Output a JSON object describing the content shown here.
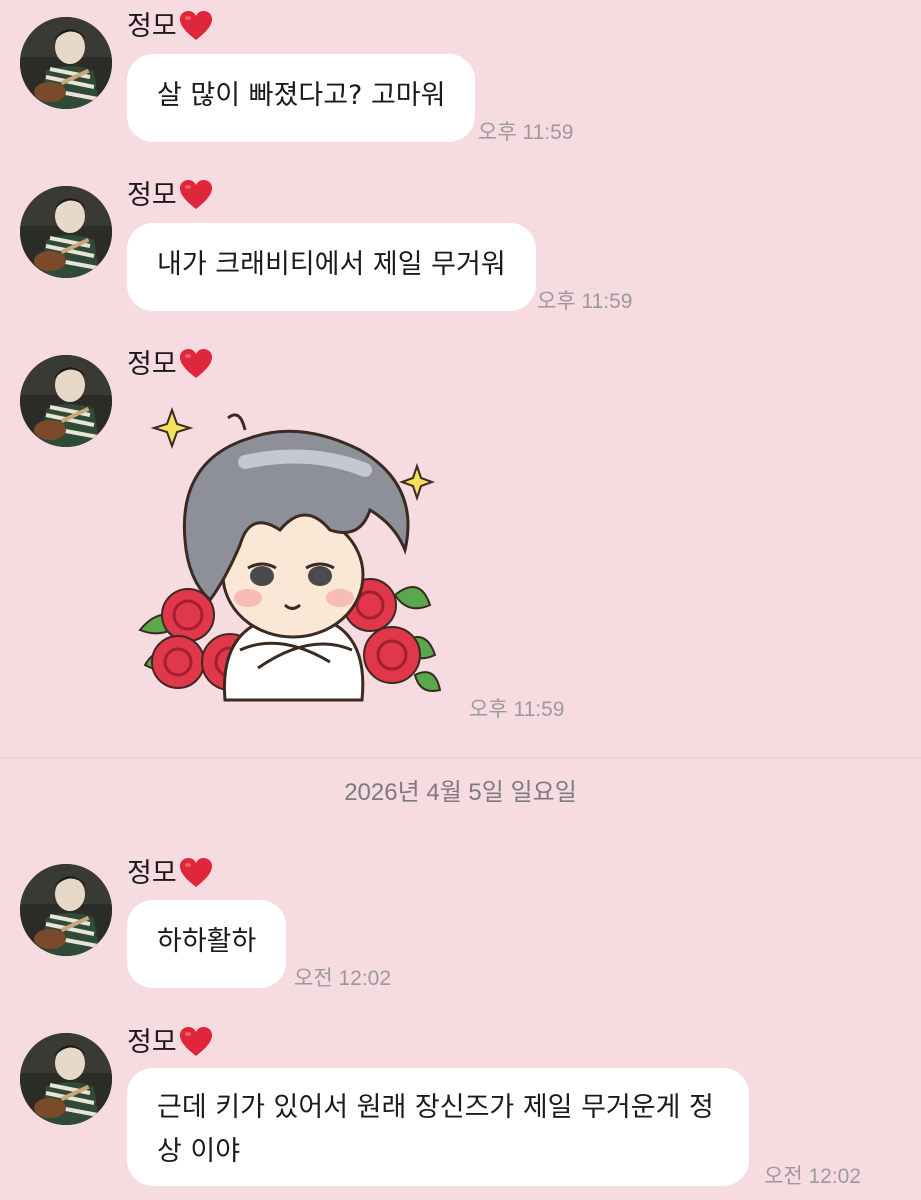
{
  "sender_name": "정모",
  "messages": [
    {
      "text": "살 많이 빠졌다고? 고마워",
      "time": "오후 11:59"
    },
    {
      "text": "내가 크래비티에서 제일 무거워",
      "time": "오후 11:59"
    },
    {
      "sticker": "chibi-boy-with-roses-sticker",
      "time": "오후 11:59"
    },
    {
      "text": "하하활하",
      "time": "오전 12:02"
    },
    {
      "text": "근데 키가 있어서 원래 장신즈가 제일 무거운게 정상 이야",
      "time": "오전 12:02"
    }
  ],
  "date_separator": "2026년 4월 5일 일요일",
  "colors": {
    "background": "#f6dbe1",
    "bubble": "#ffffff",
    "heart": "#e0263a",
    "time_text": "#9c9a9b"
  }
}
